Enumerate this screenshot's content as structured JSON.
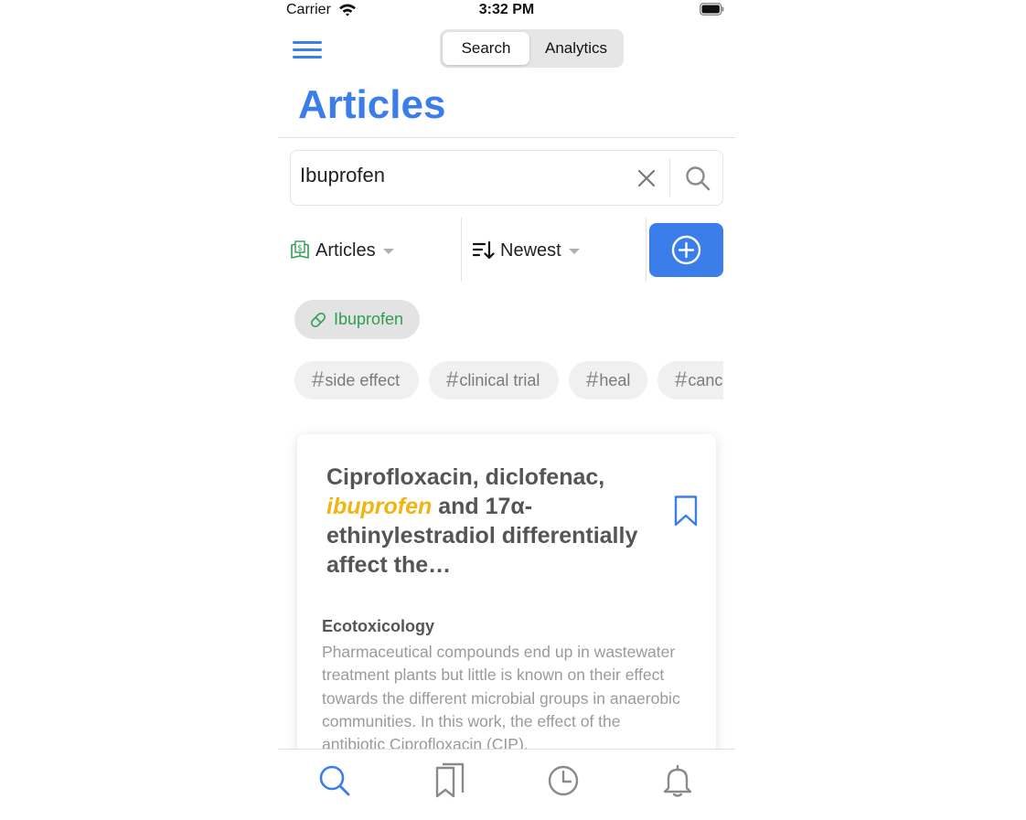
{
  "status_bar": {
    "carrier": "Carrier",
    "time": "3:32 PM"
  },
  "header": {
    "segments": [
      "Search",
      "Analytics"
    ],
    "selected_segment": "Search",
    "title": "Articles"
  },
  "search": {
    "value": "Ibuprofen"
  },
  "filters": {
    "source_label": "Articles",
    "sort_label": "Newest"
  },
  "drug_chip": {
    "label": "Ibuprofen"
  },
  "tags": [
    {
      "label": "side effect"
    },
    {
      "label": "clinical trial"
    },
    {
      "label": "heal"
    },
    {
      "label": "canc"
    }
  ],
  "article": {
    "title_before": "Ciprofloxacin, diclofenac, ",
    "title_highlight": "ibuprofen",
    "title_after": " and 17α-ethinylestradiol differentially affect the…",
    "journal": "Ecotoxicology",
    "abstract": "Pharmaceutical compounds end up in wastewater treatment plants but little is known on their effect towards the different microbial groups in anaerobic communities. In this work, the effect of the antibiotic Ciprofloxacin (CIP),"
  },
  "colors": {
    "accent": "#3b7de9",
    "highlight": "#f0b413",
    "chip_text": "#2e9f52",
    "tab_inactive": "#8a8a8a"
  },
  "icons": {
    "menu": "hamburger-icon",
    "clear": "close-icon",
    "search": "search-icon",
    "source": "book-icon",
    "sort": "sort-descending-icon",
    "add": "plus-circle-icon",
    "drug": "pill-icon",
    "bookmark": "bookmark-icon",
    "tabs": [
      "search-icon",
      "bookmarks-icon",
      "clock-icon",
      "bell-icon"
    ]
  }
}
